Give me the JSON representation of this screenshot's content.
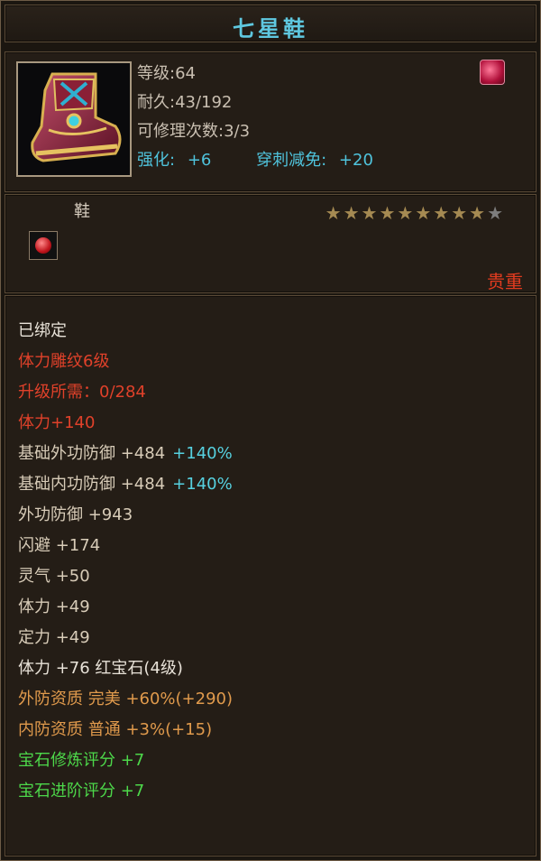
{
  "item": {
    "name": "七星鞋",
    "type": "鞋",
    "stars_filled": 9,
    "stars_total": 10,
    "quality": "贵重"
  },
  "header": {
    "level": "等级:64",
    "durability": "耐久:43/192",
    "repair": "可修理次数:3/3",
    "enhance_label": "强化:",
    "enhance_value": "+6",
    "pierce_label": "穿刺减免:",
    "pierce_value": "+20"
  },
  "attributes": [
    {
      "text": "已绑定",
      "color": "white"
    },
    {
      "text": "体力雕纹6级",
      "color": "red"
    },
    {
      "text": "升级所需：0/284",
      "color": "red"
    },
    {
      "text": "体力+140",
      "color": "red"
    },
    {
      "text": "基础外功防御 +484",
      "extra": "+140%",
      "color": "beige"
    },
    {
      "text": "基础内功防御 +484",
      "extra": "+140%",
      "color": "beige"
    },
    {
      "text": "外功防御 +943",
      "color": "beige"
    },
    {
      "text": "闪避 +174",
      "color": "beige"
    },
    {
      "text": "灵气 +50",
      "color": "beige"
    },
    {
      "text": "体力 +49",
      "color": "beige"
    },
    {
      "text": "定力 +49",
      "color": "beige"
    },
    {
      "text": "体力 +76 红宝石(4级)",
      "color": "white"
    },
    {
      "text": "外防资质  完美 +60%(+290)",
      "color": "orange"
    },
    {
      "text": "内防资质  普通 +3%(+15)",
      "color": "orange"
    },
    {
      "text": "宝石修炼评分 +7",
      "color": "green"
    },
    {
      "text": "宝石进阶评分 +7",
      "color": "green"
    }
  ],
  "colors": {
    "title": "#5fc8e0",
    "red": "#e0412a",
    "orange": "#e09a4c",
    "green": "#4dd84a",
    "cyan": "#56d1e0"
  },
  "icons": {
    "item": "boot-icon",
    "mark": "brand-mark-icon",
    "gem": "ruby-gem-icon",
    "star": "star-icon"
  }
}
